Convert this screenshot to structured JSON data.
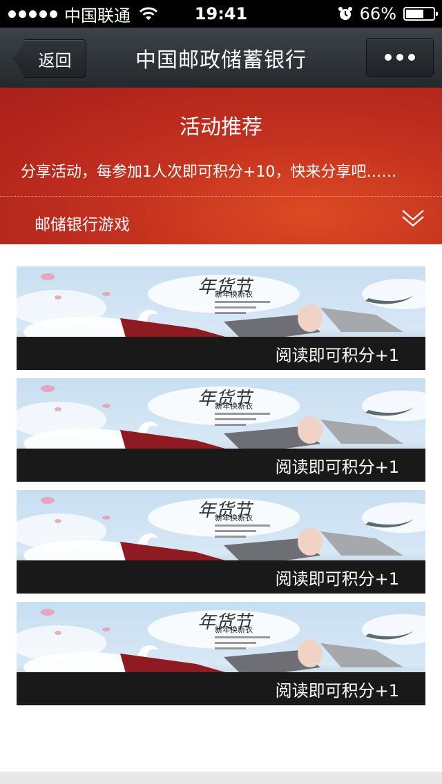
{
  "status_bar": {
    "carrier": "中国联通",
    "time": "19:41",
    "battery": "66%",
    "battery_level": 0.66
  },
  "nav": {
    "back_label": "返回",
    "title": "中国邮政储蓄银行"
  },
  "banner": {
    "title": "活动推荐",
    "description": "分享活动，每参加1人次即可积分+10，快来分享吧……",
    "section_label": "邮储银行游戏"
  },
  "cards": [
    {
      "caption": "阅读即可积分+1",
      "art_text": "年货节",
      "art_headline": "新年换新衣"
    },
    {
      "caption": "阅读即可积分+1",
      "art_text": "年货节",
      "art_headline": "新年换新衣"
    },
    {
      "caption": "阅读即可积分+1",
      "art_text": "年货节",
      "art_headline": "新年换新衣"
    },
    {
      "caption": "阅读即可积分+1",
      "art_text": "年货节",
      "art_headline": "新年换新衣"
    }
  ]
}
